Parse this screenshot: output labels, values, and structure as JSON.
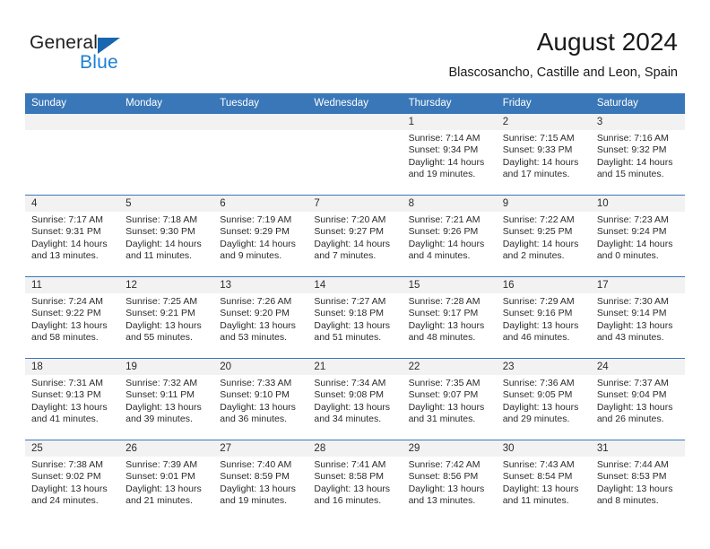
{
  "brand": {
    "word_one": "General",
    "word_two": "Blue",
    "triangle_color": "#1666b0",
    "blue_color": "#1d7fd4"
  },
  "header": {
    "month_title": "August 2024",
    "location": "Blascosancho, Castille and Leon, Spain"
  },
  "theme": {
    "header_blue": "#3a77b8",
    "daynum_band": "#f2f2f2",
    "text": "#2b2b2b"
  },
  "calendar": {
    "weekday_headers": [
      "Sunday",
      "Monday",
      "Tuesday",
      "Wednesday",
      "Thursday",
      "Friday",
      "Saturday"
    ],
    "labels": {
      "sunrise": "Sunrise:",
      "sunset": "Sunset:",
      "daylight": "Daylight:"
    },
    "weeks": [
      [
        {
          "blank": true,
          "day": "",
          "sunrise": "",
          "sunset": "",
          "daylight_line1": "",
          "daylight_line2": ""
        },
        {
          "blank": true,
          "day": "",
          "sunrise": "",
          "sunset": "",
          "daylight_line1": "",
          "daylight_line2": ""
        },
        {
          "blank": true,
          "day": "",
          "sunrise": "",
          "sunset": "",
          "daylight_line1": "",
          "daylight_line2": ""
        },
        {
          "blank": true,
          "day": "",
          "sunrise": "",
          "sunset": "",
          "daylight_line1": "",
          "daylight_line2": ""
        },
        {
          "blank": false,
          "day": "1",
          "sunrise": "Sunrise: 7:14 AM",
          "sunset": "Sunset: 9:34 PM",
          "daylight_line1": "Daylight: 14 hours",
          "daylight_line2": "and 19 minutes."
        },
        {
          "blank": false,
          "day": "2",
          "sunrise": "Sunrise: 7:15 AM",
          "sunset": "Sunset: 9:33 PM",
          "daylight_line1": "Daylight: 14 hours",
          "daylight_line2": "and 17 minutes."
        },
        {
          "blank": false,
          "day": "3",
          "sunrise": "Sunrise: 7:16 AM",
          "sunset": "Sunset: 9:32 PM",
          "daylight_line1": "Daylight: 14 hours",
          "daylight_line2": "and 15 minutes."
        }
      ],
      [
        {
          "blank": false,
          "day": "4",
          "sunrise": "Sunrise: 7:17 AM",
          "sunset": "Sunset: 9:31 PM",
          "daylight_line1": "Daylight: 14 hours",
          "daylight_line2": "and 13 minutes."
        },
        {
          "blank": false,
          "day": "5",
          "sunrise": "Sunrise: 7:18 AM",
          "sunset": "Sunset: 9:30 PM",
          "daylight_line1": "Daylight: 14 hours",
          "daylight_line2": "and 11 minutes."
        },
        {
          "blank": false,
          "day": "6",
          "sunrise": "Sunrise: 7:19 AM",
          "sunset": "Sunset: 9:29 PM",
          "daylight_line1": "Daylight: 14 hours",
          "daylight_line2": "and 9 minutes."
        },
        {
          "blank": false,
          "day": "7",
          "sunrise": "Sunrise: 7:20 AM",
          "sunset": "Sunset: 9:27 PM",
          "daylight_line1": "Daylight: 14 hours",
          "daylight_line2": "and 7 minutes."
        },
        {
          "blank": false,
          "day": "8",
          "sunrise": "Sunrise: 7:21 AM",
          "sunset": "Sunset: 9:26 PM",
          "daylight_line1": "Daylight: 14 hours",
          "daylight_line2": "and 4 minutes."
        },
        {
          "blank": false,
          "day": "9",
          "sunrise": "Sunrise: 7:22 AM",
          "sunset": "Sunset: 9:25 PM",
          "daylight_line1": "Daylight: 14 hours",
          "daylight_line2": "and 2 minutes."
        },
        {
          "blank": false,
          "day": "10",
          "sunrise": "Sunrise: 7:23 AM",
          "sunset": "Sunset: 9:24 PM",
          "daylight_line1": "Daylight: 14 hours",
          "daylight_line2": "and 0 minutes."
        }
      ],
      [
        {
          "blank": false,
          "day": "11",
          "sunrise": "Sunrise: 7:24 AM",
          "sunset": "Sunset: 9:22 PM",
          "daylight_line1": "Daylight: 13 hours",
          "daylight_line2": "and 58 minutes."
        },
        {
          "blank": false,
          "day": "12",
          "sunrise": "Sunrise: 7:25 AM",
          "sunset": "Sunset: 9:21 PM",
          "daylight_line1": "Daylight: 13 hours",
          "daylight_line2": "and 55 minutes."
        },
        {
          "blank": false,
          "day": "13",
          "sunrise": "Sunrise: 7:26 AM",
          "sunset": "Sunset: 9:20 PM",
          "daylight_line1": "Daylight: 13 hours",
          "daylight_line2": "and 53 minutes."
        },
        {
          "blank": false,
          "day": "14",
          "sunrise": "Sunrise: 7:27 AM",
          "sunset": "Sunset: 9:18 PM",
          "daylight_line1": "Daylight: 13 hours",
          "daylight_line2": "and 51 minutes."
        },
        {
          "blank": false,
          "day": "15",
          "sunrise": "Sunrise: 7:28 AM",
          "sunset": "Sunset: 9:17 PM",
          "daylight_line1": "Daylight: 13 hours",
          "daylight_line2": "and 48 minutes."
        },
        {
          "blank": false,
          "day": "16",
          "sunrise": "Sunrise: 7:29 AM",
          "sunset": "Sunset: 9:16 PM",
          "daylight_line1": "Daylight: 13 hours",
          "daylight_line2": "and 46 minutes."
        },
        {
          "blank": false,
          "day": "17",
          "sunrise": "Sunrise: 7:30 AM",
          "sunset": "Sunset: 9:14 PM",
          "daylight_line1": "Daylight: 13 hours",
          "daylight_line2": "and 43 minutes."
        }
      ],
      [
        {
          "blank": false,
          "day": "18",
          "sunrise": "Sunrise: 7:31 AM",
          "sunset": "Sunset: 9:13 PM",
          "daylight_line1": "Daylight: 13 hours",
          "daylight_line2": "and 41 minutes."
        },
        {
          "blank": false,
          "day": "19",
          "sunrise": "Sunrise: 7:32 AM",
          "sunset": "Sunset: 9:11 PM",
          "daylight_line1": "Daylight: 13 hours",
          "daylight_line2": "and 39 minutes."
        },
        {
          "blank": false,
          "day": "20",
          "sunrise": "Sunrise: 7:33 AM",
          "sunset": "Sunset: 9:10 PM",
          "daylight_line1": "Daylight: 13 hours",
          "daylight_line2": "and 36 minutes."
        },
        {
          "blank": false,
          "day": "21",
          "sunrise": "Sunrise: 7:34 AM",
          "sunset": "Sunset: 9:08 PM",
          "daylight_line1": "Daylight: 13 hours",
          "daylight_line2": "and 34 minutes."
        },
        {
          "blank": false,
          "day": "22",
          "sunrise": "Sunrise: 7:35 AM",
          "sunset": "Sunset: 9:07 PM",
          "daylight_line1": "Daylight: 13 hours",
          "daylight_line2": "and 31 minutes."
        },
        {
          "blank": false,
          "day": "23",
          "sunrise": "Sunrise: 7:36 AM",
          "sunset": "Sunset: 9:05 PM",
          "daylight_line1": "Daylight: 13 hours",
          "daylight_line2": "and 29 minutes."
        },
        {
          "blank": false,
          "day": "24",
          "sunrise": "Sunrise: 7:37 AM",
          "sunset": "Sunset: 9:04 PM",
          "daylight_line1": "Daylight: 13 hours",
          "daylight_line2": "and 26 minutes."
        }
      ],
      [
        {
          "blank": false,
          "day": "25",
          "sunrise": "Sunrise: 7:38 AM",
          "sunset": "Sunset: 9:02 PM",
          "daylight_line1": "Daylight: 13 hours",
          "daylight_line2": "and 24 minutes."
        },
        {
          "blank": false,
          "day": "26",
          "sunrise": "Sunrise: 7:39 AM",
          "sunset": "Sunset: 9:01 PM",
          "daylight_line1": "Daylight: 13 hours",
          "daylight_line2": "and 21 minutes."
        },
        {
          "blank": false,
          "day": "27",
          "sunrise": "Sunrise: 7:40 AM",
          "sunset": "Sunset: 8:59 PM",
          "daylight_line1": "Daylight: 13 hours",
          "daylight_line2": "and 19 minutes."
        },
        {
          "blank": false,
          "day": "28",
          "sunrise": "Sunrise: 7:41 AM",
          "sunset": "Sunset: 8:58 PM",
          "daylight_line1": "Daylight: 13 hours",
          "daylight_line2": "and 16 minutes."
        },
        {
          "blank": false,
          "day": "29",
          "sunrise": "Sunrise: 7:42 AM",
          "sunset": "Sunset: 8:56 PM",
          "daylight_line1": "Daylight: 13 hours",
          "daylight_line2": "and 13 minutes."
        },
        {
          "blank": false,
          "day": "30",
          "sunrise": "Sunrise: 7:43 AM",
          "sunset": "Sunset: 8:54 PM",
          "daylight_line1": "Daylight: 13 hours",
          "daylight_line2": "and 11 minutes."
        },
        {
          "blank": false,
          "day": "31",
          "sunrise": "Sunrise: 7:44 AM",
          "sunset": "Sunset: 8:53 PM",
          "daylight_line1": "Daylight: 13 hours",
          "daylight_line2": "and 8 minutes."
        }
      ]
    ]
  }
}
